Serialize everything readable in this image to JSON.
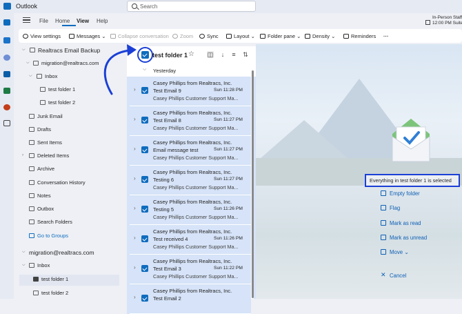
{
  "app": {
    "title": "Outlook"
  },
  "search": {
    "placeholder": "Search"
  },
  "menu": {
    "items": [
      "File",
      "Home",
      "View",
      "Help"
    ],
    "active": "View"
  },
  "meeting": {
    "title": "In-Person Staff",
    "time": "12:00 PM Suite"
  },
  "toolbar": {
    "view_settings": "View settings",
    "messages": "Messages",
    "collapse": "Collapse conversation",
    "zoom": "Zoom",
    "sync": "Sync",
    "layout": "Layout",
    "folder_pane": "Folder pane",
    "density": "Density",
    "reminders": "Reminders",
    "more": "···"
  },
  "folders": [
    {
      "label": "Realtracs Email Backup",
      "icon": "folder-icon"
    },
    {
      "label": "migration@realtracs.com",
      "icon": "mail-icon"
    },
    {
      "label": "Inbox",
      "icon": "folder-icon"
    },
    {
      "label": "test folder 1",
      "icon": "folder-icon"
    },
    {
      "label": "test folder 2",
      "icon": "folder-icon"
    },
    {
      "label": "Junk Email",
      "icon": "junk-icon"
    },
    {
      "label": "Drafts",
      "icon": "pencil-icon"
    },
    {
      "label": "Sent Items",
      "icon": "send-icon"
    },
    {
      "label": "Deleted Items",
      "icon": "trash-icon"
    },
    {
      "label": "Archive",
      "icon": "archive-icon"
    },
    {
      "label": "Conversation History",
      "icon": "folder-icon"
    },
    {
      "label": "Notes",
      "icon": "notes-icon"
    },
    {
      "label": "Outbox",
      "icon": "outbox-icon"
    },
    {
      "label": "Search Folders",
      "icon": "search-folder-icon"
    },
    {
      "label": "Go to Groups",
      "icon": "groups-icon"
    },
    {
      "label": "migration@realtracs.com",
      "icon": ""
    },
    {
      "label": "Inbox",
      "icon": "inbox-icon"
    },
    {
      "label": "test folder 1",
      "icon": "folder-icon"
    },
    {
      "label": "test folder 2",
      "icon": "folder-icon"
    }
  ],
  "list": {
    "title": "test folder 1",
    "group": "Yesterday",
    "messages": [
      {
        "sender": "Casey Phillips from Realtracs, Inc.",
        "subject": "Test Email 9",
        "time": "Sun 11:28 PM",
        "preview": "Casey Phillips Customer Support Ma..."
      },
      {
        "sender": "Casey Phillips from Realtracs, Inc.",
        "subject": "Test Email 8",
        "time": "Sun 11:27 PM",
        "preview": "Casey Phillips Customer Support Ma..."
      },
      {
        "sender": "Casey Phillips from Realtracs, Inc.",
        "subject": "Email message test",
        "time": "Sun 11:27 PM",
        "preview": "Casey Phillips Customer Support Ma..."
      },
      {
        "sender": "Casey Phillips from Realtracs, Inc.",
        "subject": "Testing 6",
        "time": "Sun 11:27 PM",
        "preview": "Casey Phillips Customer Support Ma..."
      },
      {
        "sender": "Casey Phillips from Realtracs, Inc.",
        "subject": "Testing 5",
        "time": "Sun 11:26 PM",
        "preview": "Casey Phillips Customer Support Ma..."
      },
      {
        "sender": "Casey Phillips from Realtracs, Inc.",
        "subject": "Test received 4",
        "time": "Sun 11:26 PM",
        "preview": "Casey Phillips Customer Support Ma..."
      },
      {
        "sender": "Casey Phillips from Realtracs, Inc.",
        "subject": "Test Email 3",
        "time": "Sun 11:22 PM",
        "preview": "Casey Phillips Customer Support Ma..."
      },
      {
        "sender": "Casey Phillips from Realtracs, Inc.",
        "subject": "Test Email 2",
        "time": "",
        "preview": ""
      }
    ]
  },
  "reading": {
    "status": "Everything in test folder 1 is selected",
    "actions": [
      "Empty folder",
      "Flag",
      "Mark as read",
      "Mark as unread",
      "Move",
      "Cancel"
    ]
  },
  "colors": {
    "accent": "#0f6cbd",
    "annotation": "#1b3fd6",
    "selected_row": "#d6e3f8"
  }
}
